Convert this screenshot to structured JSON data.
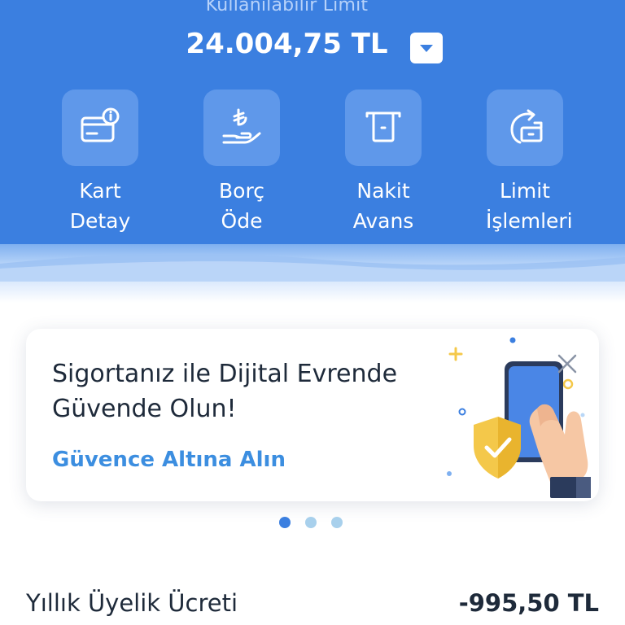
{
  "limit": {
    "label": "Kullanılabilir Limit",
    "amount": "24.004,75 TL",
    "toggle_icon": "chevron-down-icon"
  },
  "actions": [
    {
      "line1": "Kart",
      "line2": "Detay",
      "icon": "card-info-icon"
    },
    {
      "line1": "Borç",
      "line2": "Öde",
      "icon": "lira-hand-icon"
    },
    {
      "line1": "Nakit",
      "line2": "Avans",
      "icon": "atm-cash-icon"
    },
    {
      "line1": "Limit",
      "line2": "İşlemleri",
      "icon": "limit-refresh-icon"
    }
  ],
  "banner": {
    "title_line1": "Sigortanız ile Dijital Evrende",
    "title_line2": "Güvende Olun!",
    "cta": "Güvence Altına Alın",
    "close_icon": "close-icon",
    "illustration": "phone-shield-illustration"
  },
  "carousel": {
    "count": 3,
    "active_index": 0
  },
  "fee": {
    "label": "Yıllık Üyelik Ücreti",
    "amount": "-995,50 TL"
  },
  "colors": {
    "header": "#3b7fe0",
    "tile": "#5f98ea",
    "cta": "#3c8ee0",
    "text_dark": "#1e2a3a"
  }
}
